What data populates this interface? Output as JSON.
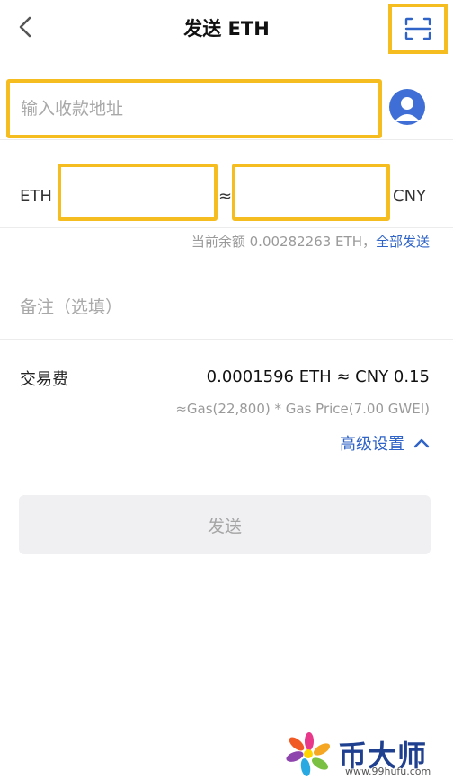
{
  "header": {
    "title": "发送 ETH"
  },
  "address": {
    "placeholder": "输入收款地址"
  },
  "amount": {
    "left_unit": "ETH",
    "approx_symbol": "≈",
    "right_unit": "CNY"
  },
  "balance": {
    "text": "当前余额 0.00282263 ETH，",
    "send_all": "全部发送"
  },
  "memo": {
    "placeholder": "备注（选填）"
  },
  "fee": {
    "label": "交易费",
    "value": "0.0001596 ETH ≈ CNY 0.15",
    "gas_detail": "≈Gas(22,800) * Gas Price(7.00 GWEI)",
    "advanced_label": "高级设置"
  },
  "send_button": {
    "label": "发送"
  },
  "watermark": {
    "brand": "币大师",
    "url": "www.99hufu.com"
  },
  "colors": {
    "highlight": "#f5bd1f",
    "accent_blue": "#2f63c7",
    "avatar_blue": "#3f6fd6"
  }
}
